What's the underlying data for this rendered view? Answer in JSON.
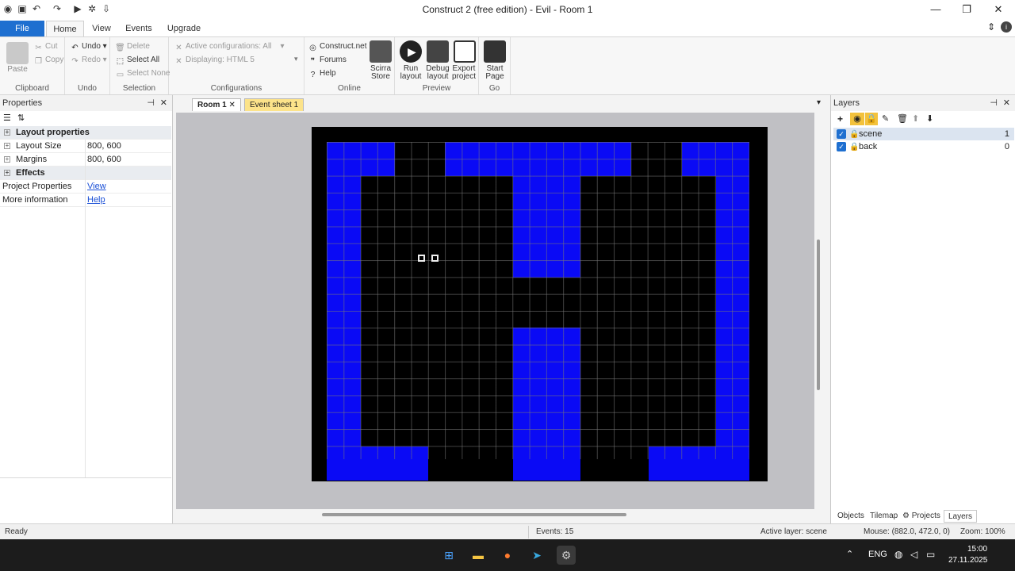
{
  "window": {
    "title": "Construct 2  (free edition) - Evil - Room 1",
    "minimize": "—",
    "restore": "❐",
    "close": "✕"
  },
  "menu_tabs": {
    "file": "File",
    "home": "Home",
    "view": "View",
    "events": "Events",
    "upgrade": "Upgrade"
  },
  "ribbon": {
    "clipboard": {
      "label": "Clipboard",
      "paste": "Paste",
      "cut": "Cut",
      "copy": "Copy"
    },
    "undo": {
      "label": "Undo",
      "undo": "Undo",
      "redo": "Redo"
    },
    "selection": {
      "label": "Selection",
      "delete": "Delete",
      "select_all": "Select All",
      "select_none": "Select None"
    },
    "configurations": {
      "label": "Configurations",
      "active": "Active configurations: All",
      "displaying": "Displaying:",
      "displaying_value": "HTML 5"
    },
    "online": {
      "label": "Online",
      "construct_net": "Construct.net",
      "forums": "Forums",
      "help": "Help",
      "scirra_line1": "Scirra",
      "scirra_line2": "Store"
    },
    "preview": {
      "label": "Preview",
      "run_line1": "Run",
      "run_line2": "layout",
      "debug_line1": "Debug",
      "debug_line2": "layout",
      "export_line1": "Export",
      "export_line2": "project"
    },
    "go": {
      "label": "Go",
      "start_line1": "Start",
      "start_line2": "Page"
    }
  },
  "properties": {
    "title": "Properties",
    "rows": [
      {
        "key": "Layout properties",
        "value": ""
      },
      {
        "key": "Layout Size",
        "value": "800, 600"
      },
      {
        "key": "Margins",
        "value": "800, 600"
      },
      {
        "key": "Effects",
        "value": ""
      },
      {
        "key": "Project Properties",
        "value": "View"
      },
      {
        "key": "More information",
        "value": "Help"
      }
    ]
  },
  "document_tabs": {
    "room": "Room 1",
    "event_sheet": "Event sheet 1"
  },
  "layers": {
    "title": "Layers",
    "items": [
      {
        "name": "scene",
        "index": "1"
      },
      {
        "name": "back",
        "index": "0"
      }
    ],
    "bottom_tabs": {
      "objects": "Objects",
      "tilemap": "Tilemap",
      "projects": "Projects",
      "layers": "Layers"
    }
  },
  "status": {
    "ready": "Ready",
    "events": "Events: 15",
    "active_layer": "Active layer: scene",
    "mouse": "Mouse: (882.0, 472.0, 0)",
    "zoom": "Zoom: 100%"
  },
  "taskbar": {
    "lang": "ENG",
    "time": "15:00",
    "date": "27.11.2025"
  },
  "colors": {
    "wall": "#0a0af5",
    "accent": "#1e6fd0"
  }
}
